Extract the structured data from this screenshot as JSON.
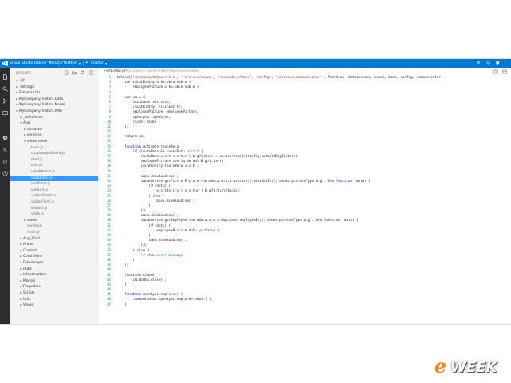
{
  "window": {
    "title": "Visual Studio Online \"Monaco\"",
    "branch": "testtest",
    "branch_icon": "branch-icon",
    "context": "master"
  },
  "activity_bar": {
    "icons": [
      "explorer-icon",
      "search-icon",
      "git-icon",
      "output-icon",
      "run-icon",
      "console-icon",
      "settings-icon",
      "help-icon"
    ]
  },
  "sidebar": {
    "title": "EXPLORE",
    "tree": [
      {
        "label": ".git",
        "kind": "folder",
        "depth": 0,
        "expanded": false
      },
      {
        "label": ".settings",
        "kind": "folder",
        "depth": 0,
        "expanded": false
      },
      {
        "label": "ExternalLibs",
        "kind": "folder",
        "depth": 0,
        "expanded": false
      },
      {
        "label": "MyCompany.Visitors.Data",
        "kind": "folder",
        "depth": 0,
        "expanded": false
      },
      {
        "label": "MyCompany.Visitors.Model",
        "kind": "folder",
        "depth": 0,
        "expanded": false
      },
      {
        "label": "MyCompany.Visitors.Web",
        "kind": "folder",
        "depth": 0,
        "expanded": true
      },
      {
        "label": "_references",
        "kind": "folder",
        "depth": 1,
        "expanded": false
      },
      {
        "label": "App",
        "kind": "folder",
        "depth": 1,
        "expanded": true
      },
      {
        "label": "durandal",
        "kind": "folder",
        "depth": 2,
        "expanded": false
      },
      {
        "label": "services",
        "kind": "folder",
        "depth": 2,
        "expanded": false
      },
      {
        "label": "viewmodels",
        "kind": "folder",
        "depth": 2,
        "expanded": true
      },
      {
        "label": "base.js",
        "kind": "file",
        "depth": 3
      },
      {
        "label": "cropImageWizard.js",
        "kind": "file",
        "depth": 3
      },
      {
        "label": "shell.js",
        "kind": "file",
        "depth": 3
      },
      {
        "label": "user.js",
        "kind": "file",
        "depth": 3
      },
      {
        "label": "viewModels.js",
        "kind": "file",
        "depth": 3
      },
      {
        "label": "visitDetail.js",
        "kind": "file",
        "depth": 3,
        "selected": true
      },
      {
        "label": "visitForm.js",
        "kind": "file",
        "depth": 3
      },
      {
        "label": "visitList.js",
        "kind": "file",
        "depth": 3
      },
      {
        "label": "visitorDetail.js",
        "kind": "file",
        "depth": 3
      },
      {
        "label": "visitorForm.js",
        "kind": "file",
        "depth": 3
      },
      {
        "label": "visitors.js",
        "kind": "file",
        "depth": 3
      },
      {
        "label": "visits.js",
        "kind": "file",
        "depth": 3
      },
      {
        "label": "views",
        "kind": "folder",
        "depth": 2,
        "expanded": false
      },
      {
        "label": "config.js",
        "kind": "file",
        "depth": 2
      },
      {
        "label": "main.js",
        "kind": "file",
        "depth": 2
      },
      {
        "label": "App_Start",
        "kind": "folder",
        "depth": 1,
        "expanded": false
      },
      {
        "label": "Areas",
        "kind": "folder",
        "depth": 1,
        "expanded": false
      },
      {
        "label": "Content",
        "kind": "folder",
        "depth": 1,
        "expanded": false
      },
      {
        "label": "Controllers",
        "kind": "folder",
        "depth": 1,
        "expanded": false
      },
      {
        "label": "Fakeimages",
        "kind": "folder",
        "depth": 1,
        "expanded": false
      },
      {
        "label": "Hubs",
        "kind": "folder",
        "depth": 1,
        "expanded": false
      },
      {
        "label": "Infrastructure",
        "kind": "folder",
        "depth": 1,
        "expanded": false
      },
      {
        "label": "Models",
        "kind": "folder",
        "depth": 1,
        "expanded": false
      },
      {
        "label": "Properties",
        "kind": "folder",
        "depth": 1,
        "expanded": false
      },
      {
        "label": "Scripts",
        "kind": "folder",
        "depth": 1,
        "expanded": false
      },
      {
        "label": "Utils",
        "kind": "folder",
        "depth": 1,
        "expanded": false
      },
      {
        "label": "Views",
        "kind": "folder",
        "depth": 1,
        "expanded": false
      }
    ]
  },
  "editor": {
    "filename": "visitDetail.js",
    "path": "/MyCompany.Visitors.Web/App/viewmodels/",
    "lines": [
      [
        [
          "t",
          "define(["
        ],
        [
          "s",
          "'services/dataservice'"
        ],
        [
          "t",
          ", "
        ],
        [
          "s",
          "'services/enums'"
        ],
        [
          "t",
          ", "
        ],
        [
          "s",
          "'viewmodels/base'"
        ],
        [
          "t",
          ", "
        ],
        [
          "s",
          "'config'"
        ],
        [
          "t",
          ", "
        ],
        [
          "s",
          "'services/communicator'"
        ],
        [
          "t",
          "], "
        ],
        [
          "k",
          "function"
        ],
        [
          "t",
          " (dataservice, enums, base, config, communicator) {"
        ]
      ],
      [
        [
          "t",
          "    "
        ],
        [
          "k",
          "var"
        ],
        [
          "t",
          " visitEntity = ko.observable(),"
        ]
      ],
      [
        [
          "t",
          "        employeePicture = ko.observable();"
        ]
      ],
      [
        [
          "t",
          ""
        ]
      ],
      [
        [
          "t",
          "    "
        ],
        [
          "k",
          "var"
        ],
        [
          "t",
          " vm = {"
        ]
      ],
      [
        [
          "t",
          "        activate: activate,"
        ]
      ],
      [
        [
          "t",
          "        visitEntity: visitEntity,"
        ]
      ],
      [
        [
          "t",
          "        employeePicture: employeePicture,"
        ]
      ],
      [
        [
          "t",
          "        openLync: openLync,"
        ]
      ],
      [
        [
          "t",
          "        close: close"
        ]
      ],
      [
        [
          "t",
          "    };"
        ]
      ],
      [
        [
          "t",
          ""
        ]
      ],
      [
        [
          "t",
          "    "
        ],
        [
          "k",
          "return"
        ],
        [
          "t",
          " vm;"
        ]
      ],
      [
        [
          "t",
          ""
        ]
      ],
      [
        [
          "t",
          "    "
        ],
        [
          "k",
          "function"
        ],
        [
          "t",
          " activate(routeData) {"
        ]
      ],
      [
        [
          "t",
          "        "
        ],
        [
          "k",
          "if"
        ],
        [
          "t",
          " (routeData && routeData.visit) {"
        ]
      ],
      [
        [
          "t",
          "            routeData.visit.visitor().bigPicture = ko.observable(config.defaultBigPicture);"
        ]
      ],
      [
        [
          "t",
          "            employeePicture(config.defaultBigPicture);"
        ]
      ],
      [
        [
          "t",
          "            visitEntity(routeData.visit);"
        ]
      ],
      [
        [
          "t",
          ""
        ]
      ],
      [
        [
          "t",
          "            base.showLoading();"
        ]
      ],
      [
        [
          "t",
          "            dataservice.getVisitorPicture(routeData.visit.visitor().visitorId(), enums.pictureType.big).then("
        ],
        [
          "k",
          "function"
        ],
        [
          "t",
          " (data) {"
        ]
      ],
      [
        [
          "t",
          "                "
        ],
        [
          "k",
          "if"
        ],
        [
          "t",
          " (data) {"
        ]
      ],
      [
        [
          "t",
          "                    visitEntity().visitor().bigPicture(data);"
        ]
      ],
      [
        [
          "t",
          "                } "
        ],
        [
          "k",
          "else"
        ],
        [
          "t",
          " {"
        ]
      ],
      [
        [
          "t",
          "                    base.hideLoading();"
        ]
      ],
      [
        [
          "t",
          "                }"
        ]
      ],
      [
        [
          "t",
          "            });"
        ]
      ],
      [
        [
          "t",
          "            base.showLoading();"
        ]
      ],
      [
        [
          "t",
          "            dataservice.getEmployee(routeData.visit.employee.employeeId(), enums.pictureType.big).then("
        ],
        [
          "k",
          "function"
        ],
        [
          "t",
          " (data) {"
        ]
      ],
      [
        [
          "t",
          "                "
        ],
        [
          "k",
          "if"
        ],
        [
          "t",
          " (data) {"
        ]
      ],
      [
        [
          "t",
          "                    employeePicture(data.picture());"
        ]
      ],
      [
        [
          "t",
          "                }"
        ]
      ],
      [
        [
          "t",
          "                base.hideLoading();"
        ]
      ],
      [
        [
          "t",
          "            });"
        ]
      ],
      [
        [
          "t",
          "        } "
        ],
        [
          "k",
          "else"
        ],
        [
          "t",
          " {"
        ]
      ],
      [
        [
          "c",
          "            // show error message"
        ]
      ],
      [
        [
          "t",
          "        }"
        ]
      ],
      [
        [
          "t",
          "    };"
        ]
      ],
      [
        [
          "t",
          ""
        ]
      ],
      [
        [
          "t",
          "    "
        ],
        [
          "k",
          "function"
        ],
        [
          "t",
          " close() {"
        ]
      ],
      [
        [
          "t",
          "        vm.modal.close();"
        ]
      ],
      [
        [
          "t",
          "    }"
        ]
      ],
      [
        [
          "t",
          ""
        ]
      ],
      [
        [
          "t",
          "    "
        ],
        [
          "k",
          "function"
        ],
        [
          "t",
          " openLync(employee) {"
        ]
      ],
      [
        [
          "t",
          "        communicator.openLync(employee.email());"
        ]
      ],
      [
        [
          "t",
          "    }"
        ]
      ]
    ]
  },
  "watermark": {
    "text_e": "e",
    "text_week": "WEEK",
    "accent_color": "#f28a1a"
  },
  "colors": {
    "titlebar": "#007acc",
    "activity_bar": "#2d2d30",
    "selection": "#3399ff",
    "keyword": "#0000ff",
    "string": "#a31515",
    "comment": "#008000",
    "line_number": "#2b91af"
  }
}
